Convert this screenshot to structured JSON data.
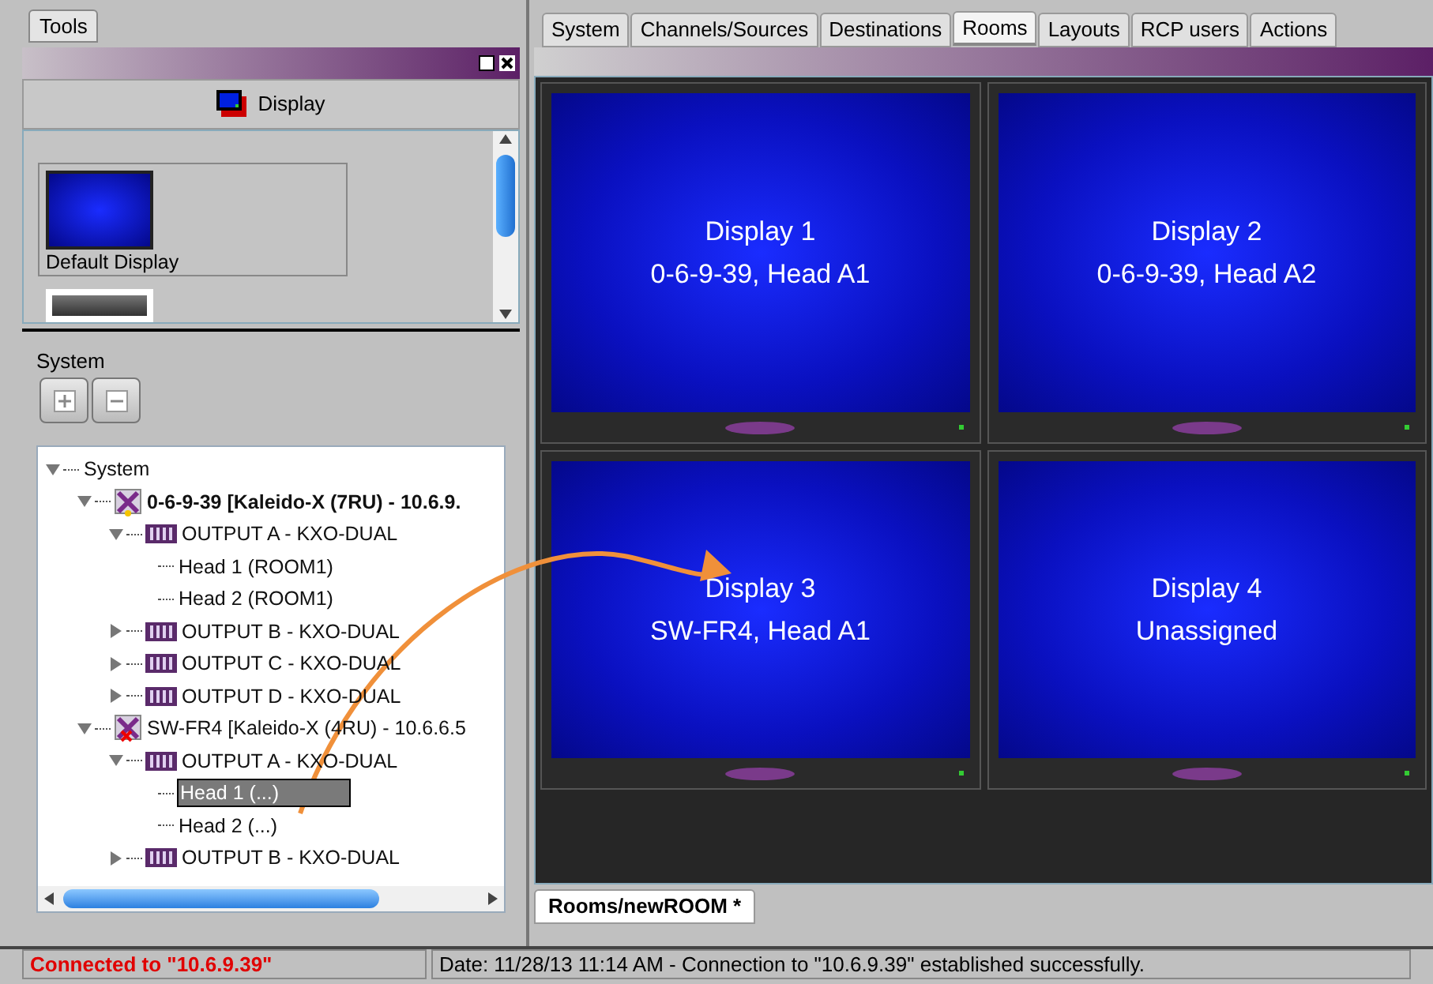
{
  "tools_tab": {
    "label": "Tools"
  },
  "display_panel": {
    "header": "Display",
    "items": [
      {
        "label": "Default Display",
        "kind": "default"
      },
      {
        "kind": "monitor"
      }
    ]
  },
  "system": {
    "label": "System"
  },
  "tree": [
    {
      "label": "System",
      "kind": "root",
      "expanded": true,
      "selected": false,
      "children": [
        {
          "label": "0-6-9-39 [Kaleido-X (7RU) - 10.6.9.",
          "kind": "device",
          "connected": true,
          "expanded": true,
          "selected": false,
          "children": [
            {
              "label": "OUTPUT A - KXO-DUAL",
              "kind": "output",
              "expanded": true,
              "selected": false,
              "children": [
                {
                  "label": "Head 1 (ROOM1)",
                  "kind": "head",
                  "selected": false
                },
                {
                  "label": "Head 2 (ROOM1)",
                  "kind": "head",
                  "selected": false
                }
              ]
            },
            {
              "label": "OUTPUT B - KXO-DUAL",
              "kind": "output",
              "expanded": false,
              "selected": false
            },
            {
              "label": "OUTPUT C - KXO-DUAL",
              "kind": "output",
              "expanded": false,
              "selected": false
            },
            {
              "label": "OUTPUT D - KXO-DUAL",
              "kind": "output",
              "expanded": false,
              "selected": false
            }
          ]
        },
        {
          "label": "SW-FR4 [Kaleido-X (4RU) - 10.6.6.5",
          "kind": "device",
          "connected": false,
          "expanded": true,
          "selected": false,
          "children": [
            {
              "label": "OUTPUT A - KXO-DUAL",
              "kind": "output",
              "expanded": true,
              "selected": false,
              "children": [
                {
                  "label": "Head 1 (...)",
                  "kind": "head",
                  "selected": true
                },
                {
                  "label": "Head 2 (...)",
                  "kind": "head",
                  "selected": false
                }
              ]
            },
            {
              "label": "OUTPUT B - KXO-DUAL",
              "kind": "output",
              "expanded": false,
              "selected": false
            }
          ]
        }
      ]
    }
  ],
  "tabs": [
    {
      "label": "System",
      "selected": false
    },
    {
      "label": "Channels/Sources",
      "selected": false
    },
    {
      "label": "Destinations",
      "selected": false
    },
    {
      "label": "Rooms",
      "selected": true
    },
    {
      "label": "Layouts",
      "selected": false
    },
    {
      "label": "RCP users",
      "selected": false
    },
    {
      "label": "Actions",
      "selected": false
    }
  ],
  "displays": [
    {
      "title": "Display 1",
      "source": "0-6-9-39, Head A1"
    },
    {
      "title": "Display 2",
      "source": "0-6-9-39, Head A2"
    },
    {
      "title": "Display 3",
      "source": "SW-FR4, Head A1"
    },
    {
      "title": "Display 4",
      "source": "Unassigned"
    }
  ],
  "document_tab": {
    "label": "Rooms/newROOM *"
  },
  "status_bar": {
    "connection": "Connected to \"10.6.9.39\"",
    "message": "Date: 11/28/13 11:14 AM - Connection to \"10.6.9.39\" established successfully."
  }
}
